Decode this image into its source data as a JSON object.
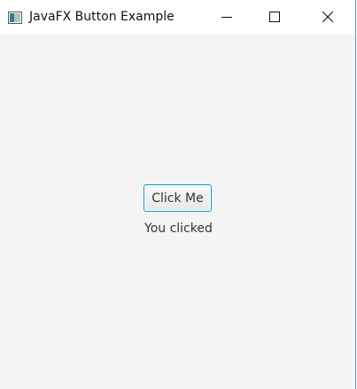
{
  "window": {
    "title": "JavaFX Button Example",
    "icons": {
      "app": "java-app-icon",
      "minimize": "minimize-icon",
      "maximize": "maximize-icon",
      "close": "close-icon"
    }
  },
  "content": {
    "button_label": "Click Me",
    "result_text": "You clicked"
  },
  "colors": {
    "window_border": "#5a8fd0",
    "content_background": "#f4f4f4",
    "button_focus_border": "#039ed3"
  }
}
